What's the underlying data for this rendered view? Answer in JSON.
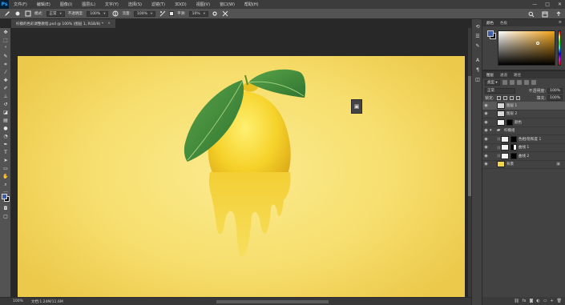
{
  "menubar": {
    "logo": "Ps",
    "items": [
      "文件(F)",
      "编辑(E)",
      "图像(I)",
      "图层(L)",
      "文字(Y)",
      "选择(S)",
      "滤镜(T)",
      "3D(D)",
      "视图(V)",
      "窗口(W)",
      "帮助(H)"
    ],
    "controls": [
      "—",
      "□",
      "✕"
    ]
  },
  "options": {
    "mode_label": "模式:",
    "mode_value": "正常",
    "opacity_label": "不透明度:",
    "opacity_value": "100%",
    "flow_label": "流量:",
    "flow_value": "100%",
    "smooth_label": "平滑:",
    "smooth_value": "10%"
  },
  "document": {
    "tab_title": "柠檬的色彩调整教程.psd @ 100% (图层 1, RGB/8) *",
    "close": "×"
  },
  "status": {
    "zoom": "100%",
    "doc_info": "文档:1.24M/11.6M"
  },
  "color_panel": {
    "tabs": [
      "颜色",
      "色板"
    ],
    "active_tab": "颜色",
    "menu": "≡",
    "foreground": "#3a5ea7",
    "background": "#000000"
  },
  "layers_panel": {
    "tabs": [
      "图层",
      "通道",
      "路径"
    ],
    "filter_label": "类型",
    "blend_mode": "正常",
    "opacity_label": "不透明度:",
    "opacity_value": "100%",
    "lock_label": "锁定:",
    "fill_label": "填充:",
    "fill_value": "100%",
    "layers": [
      {
        "name": "图层 1",
        "selected": true,
        "thumb": "grey"
      },
      {
        "name": "图层 2",
        "selected": false,
        "thumb": "grey"
      },
      {
        "name": "颜色",
        "selected": false,
        "thumb": "adj"
      },
      {
        "name": "柠檬组",
        "selected": false,
        "thumb": "folder"
      },
      {
        "name": "色相/饱和度 1",
        "selected": false,
        "thumb": "mask-black"
      },
      {
        "name": "曲线 1",
        "selected": false,
        "thumb": "mask-mixed"
      },
      {
        "name": "曲线 2",
        "selected": false,
        "thumb": "mask-black"
      },
      {
        "name": "背景",
        "selected": false,
        "thumb": "yellow"
      }
    ]
  },
  "icons": {
    "eye": "👁",
    "folder": "▸",
    "lock": "🔒"
  }
}
